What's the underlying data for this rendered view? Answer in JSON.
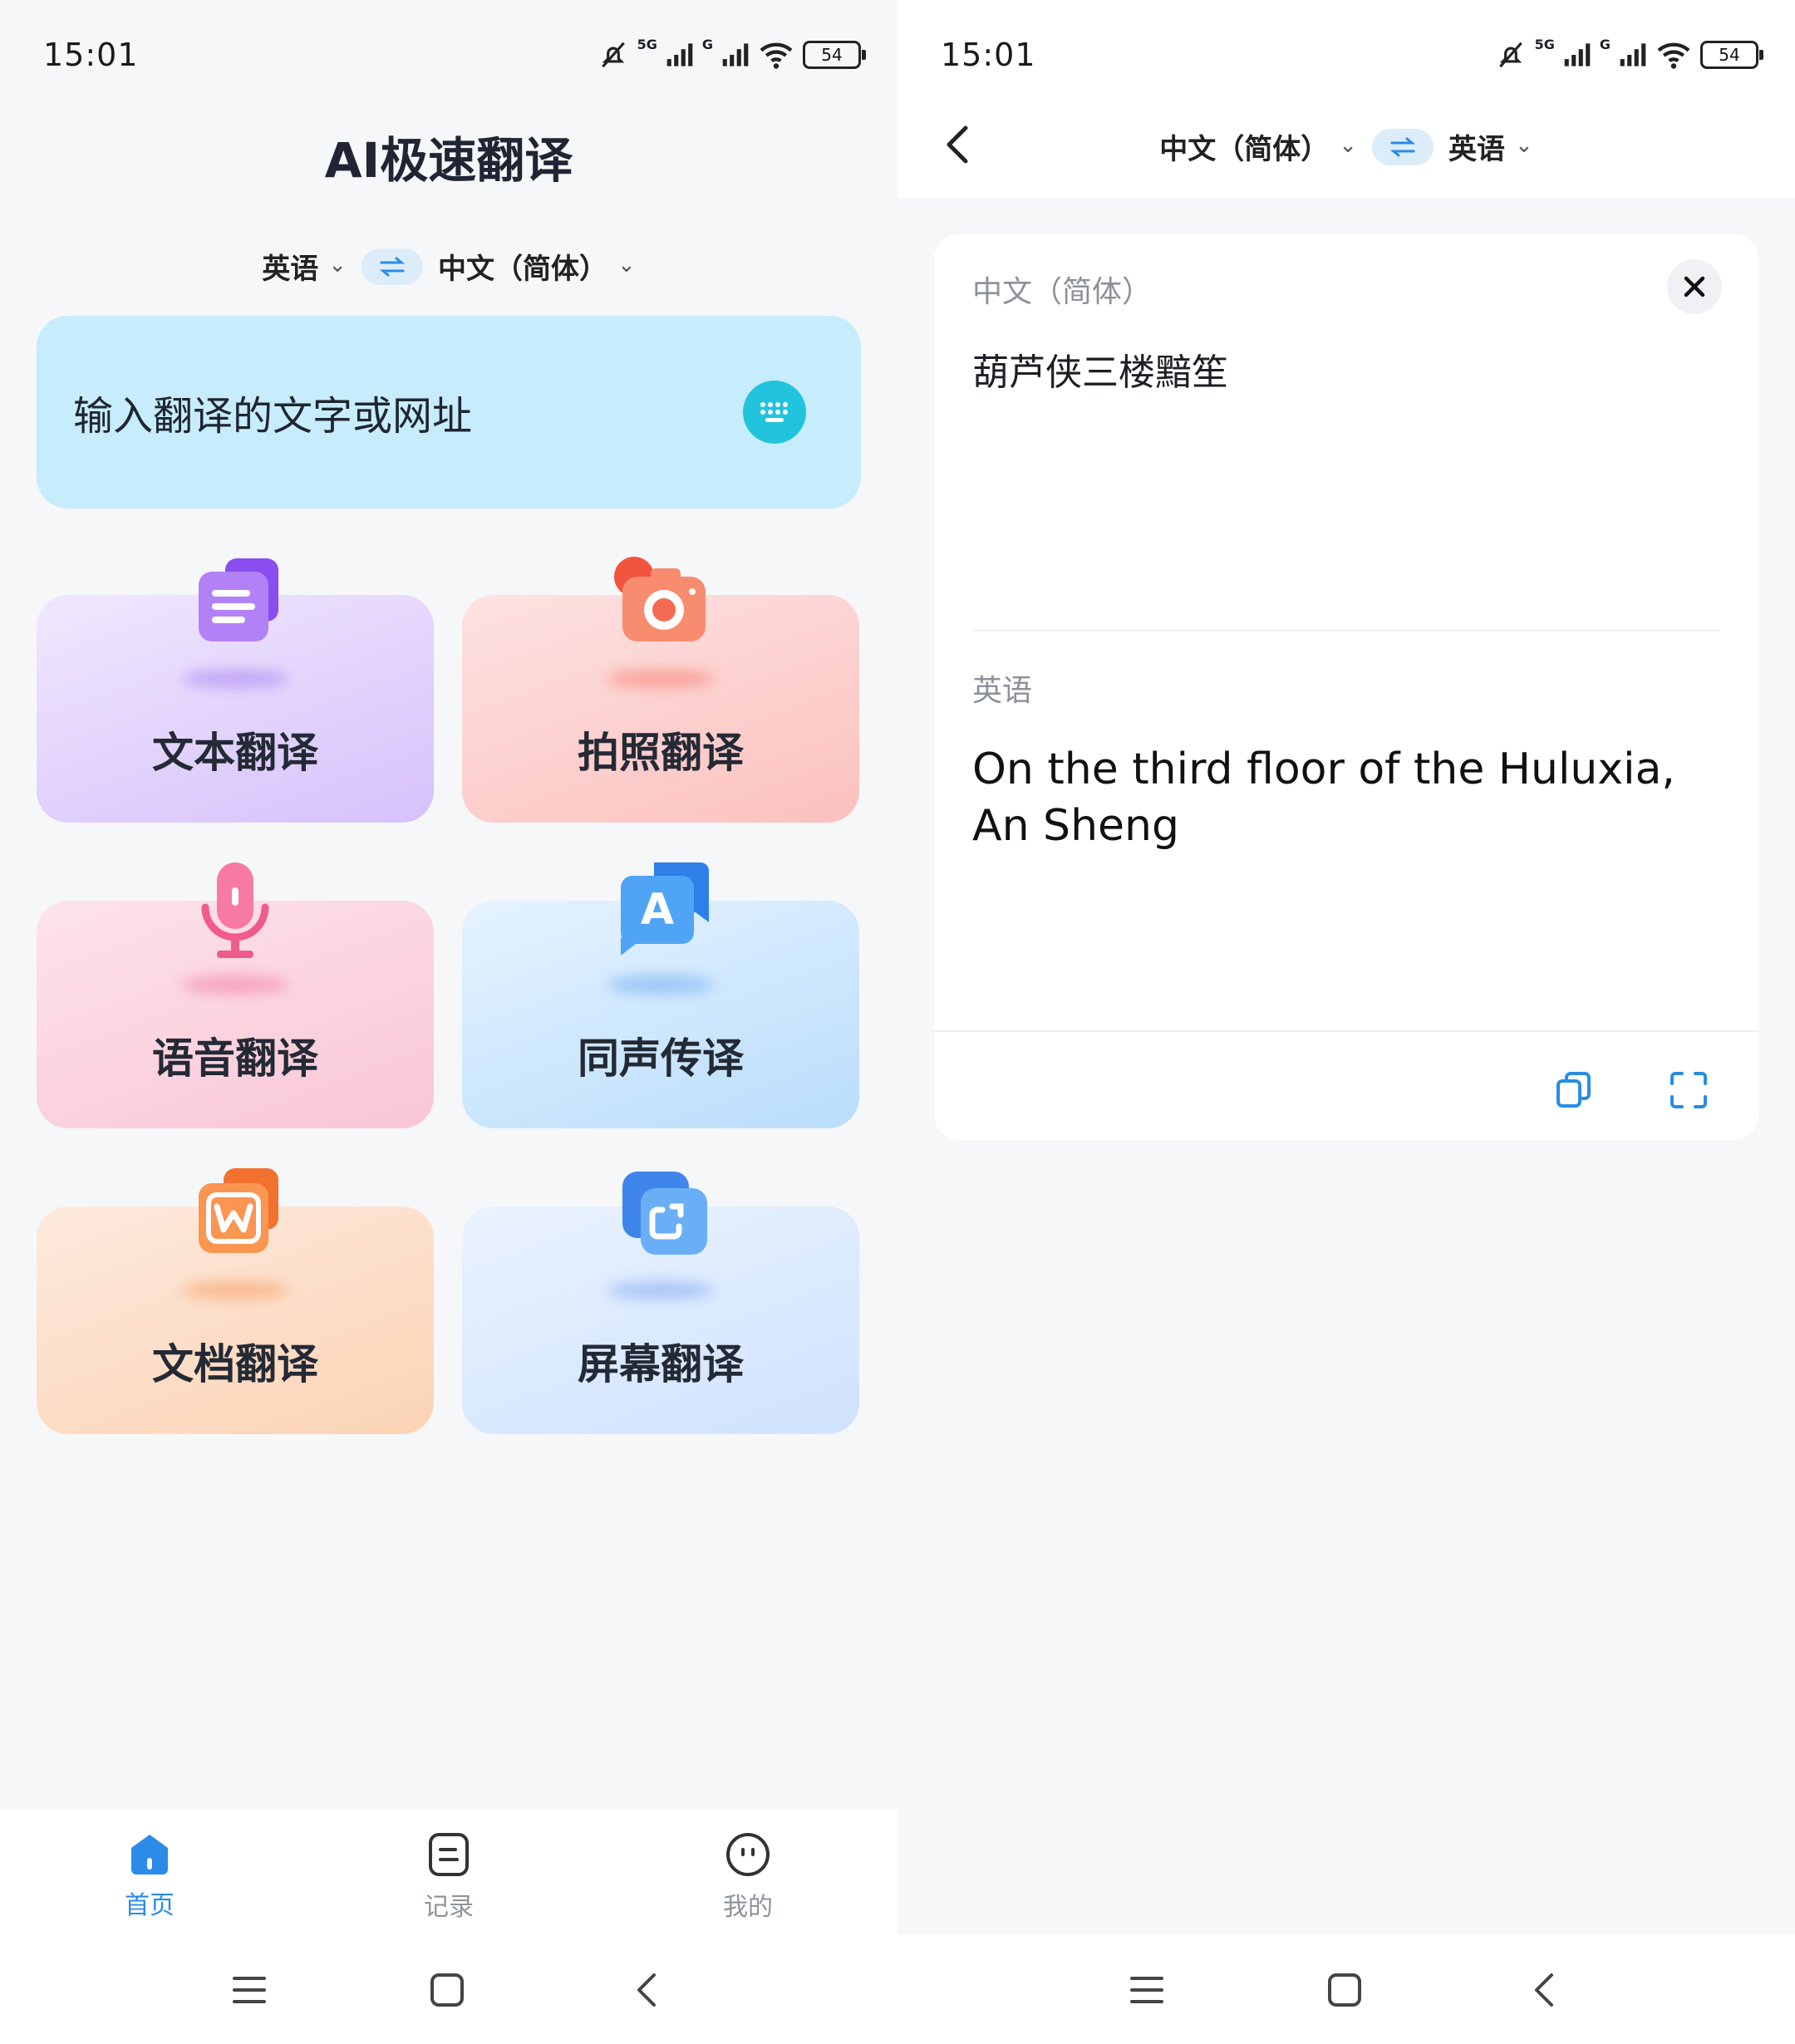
{
  "left": {
    "status": {
      "time": "15:01",
      "battery": "54",
      "network_labels": [
        "5G",
        "G"
      ]
    },
    "title": "AI极速翻译",
    "lang": {
      "source": "英语",
      "target": "中文（简体）"
    },
    "input_placeholder": "输入翻译的文字或网址",
    "features": [
      {
        "label": "文本翻译",
        "icon": "document-text-icon"
      },
      {
        "label": "拍照翻译",
        "icon": "camera-icon"
      },
      {
        "label": "语音翻译",
        "icon": "microphone-icon"
      },
      {
        "label": "同声传译",
        "icon": "simultaneous-interpret-icon"
      },
      {
        "label": "文档翻译",
        "icon": "word-document-icon"
      },
      {
        "label": "屏幕翻译",
        "icon": "screen-capture-icon"
      }
    ],
    "tabs": [
      {
        "label": "首页",
        "active": true
      },
      {
        "label": "记录",
        "active": false
      },
      {
        "label": "我的",
        "active": false
      }
    ]
  },
  "right": {
    "status": {
      "time": "15:01",
      "battery": "54",
      "network_labels": [
        "5G",
        "G"
      ]
    },
    "lang": {
      "source": "中文（简体）",
      "target": "英语"
    },
    "source_label": "中文（简体）",
    "source_text": "葫芦侠三楼黯笙",
    "target_label": "英语",
    "target_text": "On the third floor of the Huluxia, An Sheng"
  },
  "colors": {
    "accent": "#2a8ce6",
    "input_card": "#c7ecfb",
    "keyboard_button": "#22c3dc",
    "tab_inactive": "#8e939b"
  }
}
